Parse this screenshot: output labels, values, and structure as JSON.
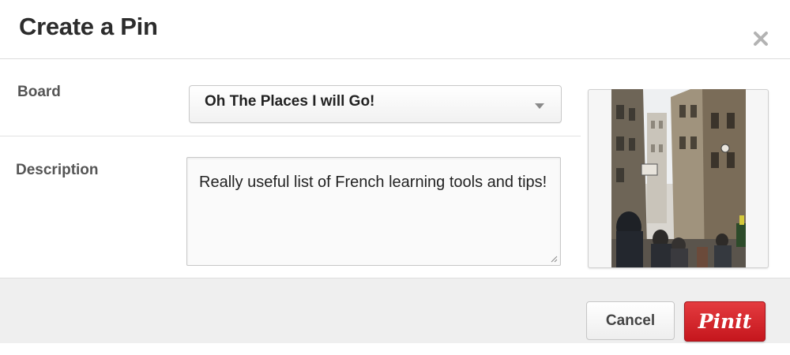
{
  "dialog": {
    "title": "Create a Pin",
    "close_icon": "close-icon"
  },
  "form": {
    "board_label": "Board",
    "board_value": "Oh The Places I will Go!",
    "description_label": "Description",
    "description_value": "Really useful list of French learning tools and tips!"
  },
  "footer": {
    "cancel_label": "Cancel",
    "pin_label": "Pinit"
  },
  "colors": {
    "pin_button": "#cb2027",
    "footer_bg": "#efefef"
  }
}
